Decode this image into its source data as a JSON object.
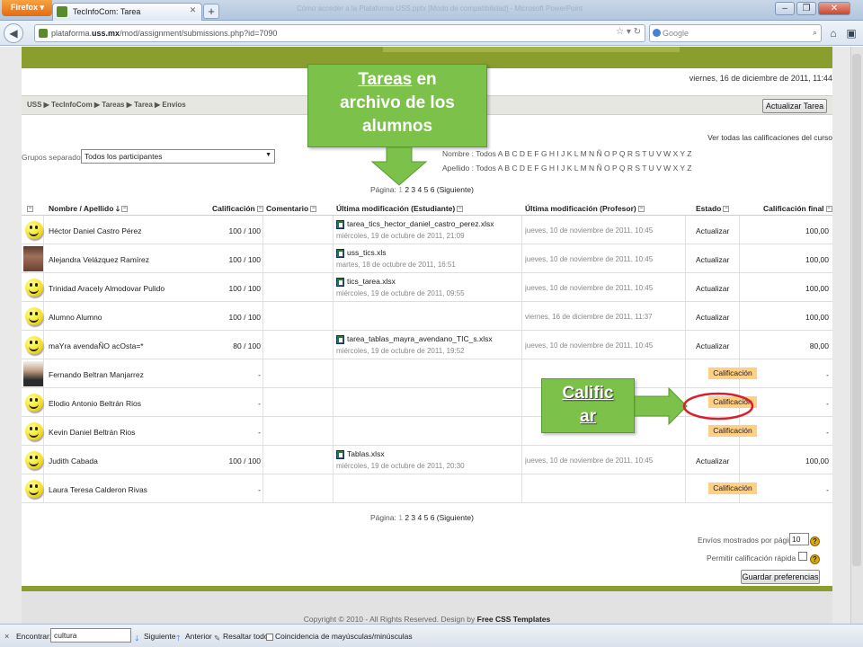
{
  "browser": {
    "menu_button": "Firefox",
    "tab_title": "TecInfoCom: Tarea",
    "window_title": "Cómo acceder a la Plataforma USS.pptx [Modo de compatibilidad] - Microsoft PowerPoint",
    "url_prefix": "plataforma.",
    "url_domain": "uss.mx",
    "url_path": "/mod/assignment/submissions.php?id=7090",
    "search_placeholder": "Google"
  },
  "page": {
    "date": "viernes, 16 de diciembre de 2011, 11:44",
    "breadcrumb": "USS ▶ TecInfoCom ▶ Tareas ▶ Tarea ▶ Envíos",
    "update_button": "Actualizar Tarea",
    "view_all_link": "Ver todas las calificaciones del curso",
    "group_label": "Grupos separados",
    "group_value": "Todos los participantes",
    "name_filter_label": "Nombre :",
    "surname_filter_label": "Apellido :",
    "filter_all": "Todos",
    "letters": [
      "A",
      "B",
      "C",
      "D",
      "E",
      "F",
      "G",
      "H",
      "I",
      "J",
      "K",
      "L",
      "M",
      "N",
      "Ñ",
      "O",
      "P",
      "Q",
      "R",
      "S",
      "T",
      "U",
      "V",
      "W",
      "X",
      "Y",
      "Z"
    ],
    "pager_label": "Página:",
    "pages": [
      "1",
      "2",
      "3",
      "4",
      "5",
      "6"
    ],
    "pager_next": "(Siguiente)"
  },
  "table": {
    "headers": {
      "name": "Nombre / Apellido",
      "grade": "Calificación",
      "comment": "Comentario",
      "last_student": "Última modificación (Estudiante)",
      "last_teacher": "Última modificación (Profesor)",
      "status": "Estado",
      "final_grade": "Calificación final"
    },
    "rows": [
      {
        "name": "Héctor Daniel Castro Pérez",
        "avatar": "smiley",
        "grade": "100 / 100",
        "file": "tarea_tics_hector_daniel_castro_perez.xlsx",
        "file_date": "miércoles, 19 de octubre de 2011, 21:09",
        "teacher_date": "jueves, 10 de noviembre de 2011, 10:45",
        "status": "Actualizar",
        "status_type": "link",
        "final": "100,00"
      },
      {
        "name": "Alejandra Velázquez Ramírez",
        "avatar": "photo-f",
        "grade": "100 / 100",
        "file": "uss_tics.xls",
        "file_date": "martes, 18 de octubre de 2011, 16:51",
        "teacher_date": "jueves, 10 de noviembre de 2011, 10:45",
        "status": "Actualizar",
        "status_type": "link",
        "final": "100,00"
      },
      {
        "name": "Trinidad Aracely Almodovar Pulido",
        "avatar": "smiley",
        "grade": "100 / 100",
        "file": "tics_tarea.xlsx",
        "file_date": "miércoles, 19 de octubre de 2011, 09:55",
        "teacher_date": "jueves, 10 de noviembre de 2011, 10:45",
        "status": "Actualizar",
        "status_type": "link",
        "final": "100,00"
      },
      {
        "name": "Alumno Alumno",
        "avatar": "smiley",
        "grade": "100 / 100",
        "file": "",
        "file_date": "",
        "teacher_date": "viernes, 16 de diciembre de 2011, 11:37",
        "status": "Actualizar",
        "status_type": "link",
        "final": "100,00"
      },
      {
        "name": "maYra avendaÑO acOsta=*",
        "avatar": "smiley",
        "grade": "80 / 100",
        "file": "tarea_tablas_mayra_avendano_TIC_s.xlsx",
        "file_date": "miércoles, 19 de octubre de 2011, 19:52",
        "teacher_date": "jueves, 10 de noviembre de 2011, 10:45",
        "status": "Actualizar",
        "status_type": "link",
        "final": "80,00"
      },
      {
        "name": "Fernando Beltran Manjarrez",
        "avatar": "photo-m",
        "grade": "-",
        "file": "",
        "file_date": "",
        "teacher_date": "",
        "status": "Calificación",
        "status_type": "grade",
        "final": "-"
      },
      {
        "name": "Elodio Antonio Beltrán Rios",
        "avatar": "smiley",
        "grade": "-",
        "file": "",
        "file_date": "",
        "teacher_date": "",
        "status": "Calificación",
        "status_type": "grade",
        "final": "-"
      },
      {
        "name": "Kevin Daniel Beltrán Rios",
        "avatar": "smiley",
        "grade": "-",
        "file": "",
        "file_date": "",
        "teacher_date": "",
        "status": "Calificación",
        "status_type": "grade",
        "final": "-"
      },
      {
        "name": "Judith Cabada",
        "avatar": "smiley",
        "grade": "100 / 100",
        "file": "Tablas.xlsx",
        "file_date": "miércoles, 19 de octubre de 2011, 20:30",
        "teacher_date": "jueves, 10 de noviembre de 2011, 10:45",
        "status": "Actualizar",
        "status_type": "link",
        "final": "100,00"
      },
      {
        "name": "Laura Teresa Calderon Rivas",
        "avatar": "smiley",
        "grade": "-",
        "file": "",
        "file_date": "",
        "teacher_date": "",
        "status": "Calificación",
        "status_type": "grade",
        "final": "-"
      }
    ]
  },
  "bottom": {
    "per_page_label": "Envíos mostrados por página",
    "per_page_value": "10",
    "quick_grading_label": "Permitir calificación rápida",
    "help_symbol": "?",
    "save_button": "Guardar preferencias",
    "copyright_prefix": "Copyright © 2010 - All Rights Reserved. Design by ",
    "copyright_brand": "Free CSS Templates"
  },
  "findbar": {
    "close": "×",
    "label": "Encontrar:",
    "value": "cultura",
    "next": "Siguiente",
    "prev": "Anterior",
    "highlight": "Resaltar todo",
    "match_case": "Coincidencia de mayúsculas/minúsculas"
  },
  "annotations": {
    "callout1_underlined": "Tareas",
    "callout1_rest_line1": " en",
    "callout1_line2": "archivo de los",
    "callout1_line3": "alumnos",
    "callout2_line1": "Calific",
    "callout2_line2": "ar",
    "arrow_color": "#7cc24a",
    "circle_color": "#d9202a"
  },
  "colors": {
    "site_green": "#8a9d2f",
    "grade_badge": "#ffcf86"
  }
}
